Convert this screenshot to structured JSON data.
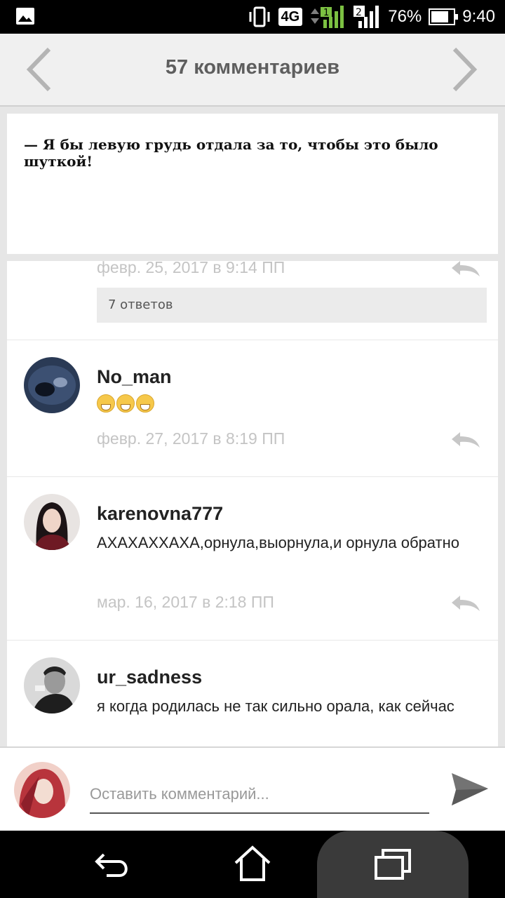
{
  "status_bar": {
    "network": "4G",
    "sim1": "1",
    "sim2": "2",
    "battery": "76%",
    "time": "9:40"
  },
  "header": {
    "title": "57 комментариев"
  },
  "quote": {
    "text": "— Я бы левую грудь отдала за то, чтобы это было шуткой!"
  },
  "partial_comment": {
    "date": "февр. 25, 2017 в 9:14 ПП",
    "replies_label": "7 ответов"
  },
  "comments": [
    {
      "username": "No_man",
      "text": "",
      "emoji_count": 3,
      "date": "февр. 27, 2017 в 8:19 ПП"
    },
    {
      "username": "karenovna777",
      "text": "АХАХАХХАХА,орнула,выорнула,и орнула обратно",
      "date": "мар. 16, 2017 в 2:18 ПП"
    },
    {
      "username": "ur_sadness",
      "text": "я когда родилась не так сильно орала, как сейчас",
      "date": ""
    }
  ],
  "composer": {
    "placeholder": "Оставить комментарий..."
  },
  "colors": {
    "header_bg": "#f0f0f0",
    "title": "#5e5e5e",
    "date": "#c4c4c4",
    "signal_green": "#7cc142"
  }
}
